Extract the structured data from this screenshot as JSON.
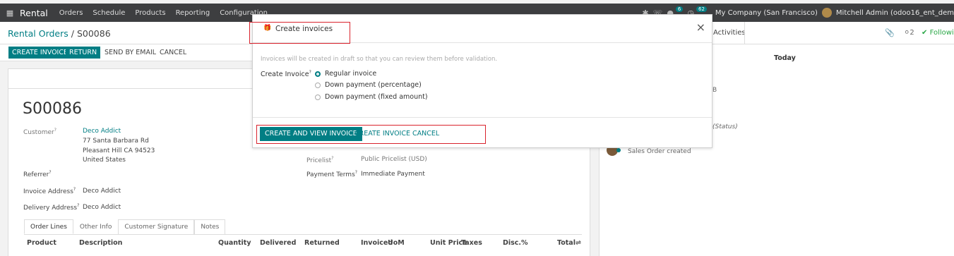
{
  "topnav": {
    "brand": "Rental",
    "menus": [
      "Orders",
      "Schedule",
      "Products",
      "Reporting",
      "Configuration"
    ],
    "messages_badge": "6",
    "activities_badge": "62",
    "company": "My Company (San Francisco)",
    "user": "Mitchell Admin (odoo16_ent_dem"
  },
  "control_panel": {
    "breadcrumb_parent": "Rental Orders",
    "breadcrumb_sep": " / ",
    "breadcrumb_current": "S00086",
    "activities": "Activities",
    "followers_count": "2",
    "following": "Following"
  },
  "actions": {
    "create_invoice": "CREATE INVOICE",
    "return": "RETURN",
    "send_by_email": "SEND BY EMAIL",
    "cancel": "CANCEL"
  },
  "order": {
    "number": "S00086",
    "customer_label": "Customer",
    "customer_name": "Deco Addict",
    "address1": "77 Santa Barbara Rd",
    "address2": "Pleasant Hill CA 94523",
    "address3": "United States",
    "referrer_label": "Referrer",
    "invoice_address_label": "Invoice Address",
    "invoice_address": "Deco Addict",
    "delivery_address_label": "Delivery Address",
    "delivery_address": "Deco Addict",
    "pricelist_label": "Pricelist",
    "pricelist": "Public Pricelist (USD)",
    "payment_terms_label": "Payment Terms",
    "payment_terms": "Immediate Payment",
    "help_mark": "?"
  },
  "tabs": [
    "Order Lines",
    "Other Info",
    "Customer Signature",
    "Notes"
  ],
  "table_headers": {
    "product": "Product",
    "description": "Description",
    "quantity": "Quantity",
    "delivered": "Delivered",
    "returned": "Returned",
    "invoiced": "Invoiced",
    "uom": "UoM",
    "unit_price": "Unit Price",
    "taxes": "Taxes",
    "disc": "Disc.%",
    "total": "Total"
  },
  "chatter": {
    "today": "Today",
    "status_text": "(Status)",
    "log_text": "Sales Order created"
  },
  "modal": {
    "title": "Create invoices",
    "hint": "Invoices will be created in draft so that you can review them before validation.",
    "create_invoice_label": "Create Invoice",
    "options": [
      {
        "label": "Regular invoice",
        "checked": true
      },
      {
        "label": "Down payment (percentage)",
        "checked": false
      },
      {
        "label": "Down payment (fixed amount)",
        "checked": false
      }
    ],
    "btn_create_and_view": "CREATE AND VIEW INVOICE",
    "btn_create": "CREATE INVOICE",
    "btn_cancel": "CANCEL"
  },
  "colors": {
    "primary": "#017e84",
    "navbar": "#3d3e40",
    "highlight": "#d9232d"
  }
}
